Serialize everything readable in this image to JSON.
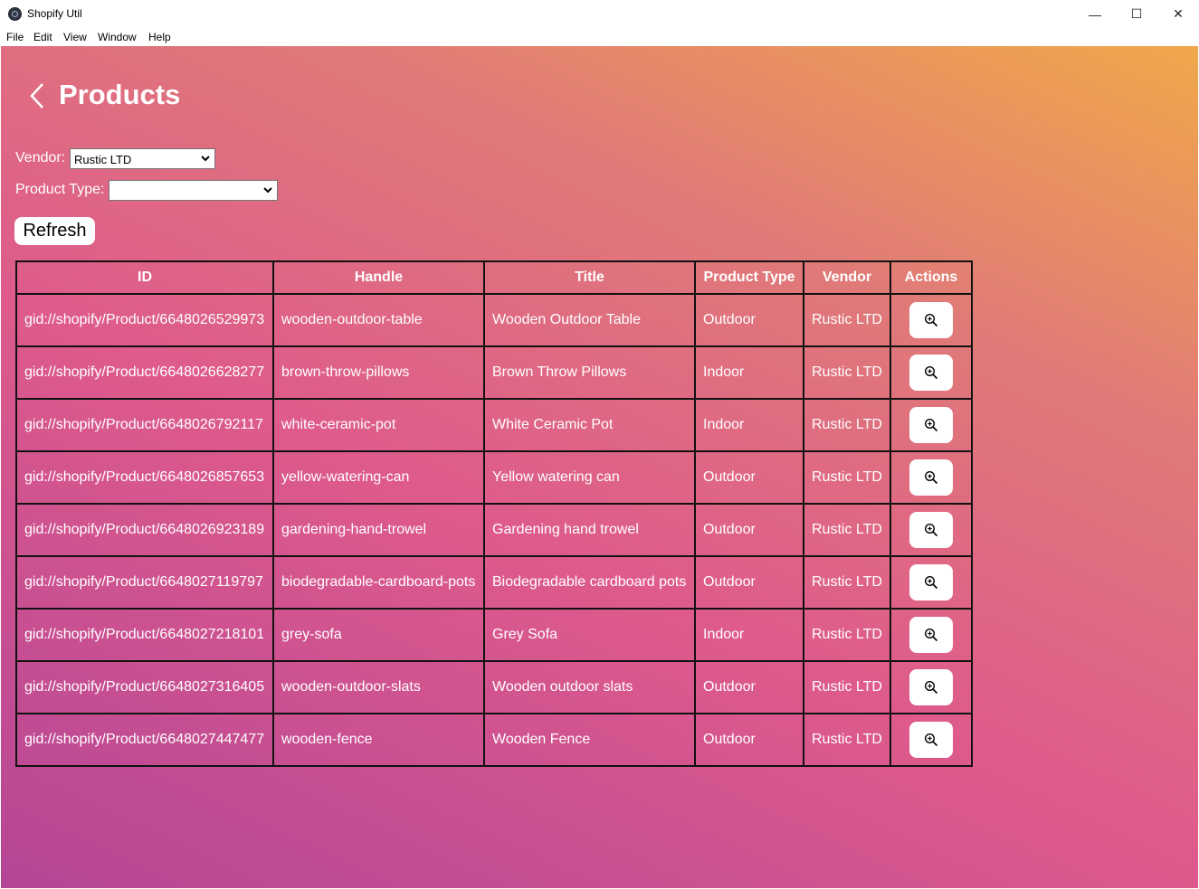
{
  "window": {
    "title": "Shopify Util",
    "controls": {
      "minimize": "—",
      "maximize": "☐",
      "close": "✕"
    }
  },
  "menu": [
    "File",
    "Edit",
    "View",
    "Window",
    "Help"
  ],
  "page": {
    "title": "Products",
    "back_icon": "chevron-left-icon"
  },
  "filters": {
    "vendor_label": "Vendor:",
    "vendor_value": "Rustic LTD",
    "product_type_label": "Product Type:",
    "product_type_value": ""
  },
  "refresh_label": "Refresh",
  "table": {
    "columns": [
      "ID",
      "Handle",
      "Title",
      "Product Type",
      "Vendor",
      "Actions"
    ],
    "action_icon": "zoom-in-icon",
    "rows": [
      [
        "gid://shopify/Product/6648026529973",
        "wooden-outdoor-table",
        "Wooden Outdoor Table",
        "Outdoor",
        "Rustic LTD"
      ],
      [
        "gid://shopify/Product/6648026628277",
        "brown-throw-pillows",
        "Brown Throw Pillows",
        "Indoor",
        "Rustic LTD"
      ],
      [
        "gid://shopify/Product/6648026792117",
        "white-ceramic-pot",
        "White Ceramic Pot",
        "Indoor",
        "Rustic LTD"
      ],
      [
        "gid://shopify/Product/6648026857653",
        "yellow-watering-can",
        "Yellow watering can",
        "Outdoor",
        "Rustic LTD"
      ],
      [
        "gid://shopify/Product/6648026923189",
        "gardening-hand-trowel",
        "Gardening hand trowel",
        "Outdoor",
        "Rustic LTD"
      ],
      [
        "gid://shopify/Product/6648027119797",
        "biodegradable-cardboard-pots",
        "Biodegradable cardboard pots",
        "Outdoor",
        "Rustic LTD"
      ],
      [
        "gid://shopify/Product/6648027218101",
        "grey-sofa",
        "Grey Sofa",
        "Indoor",
        "Rustic LTD"
      ],
      [
        "gid://shopify/Product/6648027316405",
        "wooden-outdoor-slats",
        "Wooden outdoor slats",
        "Outdoor",
        "Rustic LTD"
      ],
      [
        "gid://shopify/Product/6648027447477",
        "wooden-fence",
        "Wooden Fence",
        "Outdoor",
        "Rustic LTD"
      ]
    ]
  }
}
